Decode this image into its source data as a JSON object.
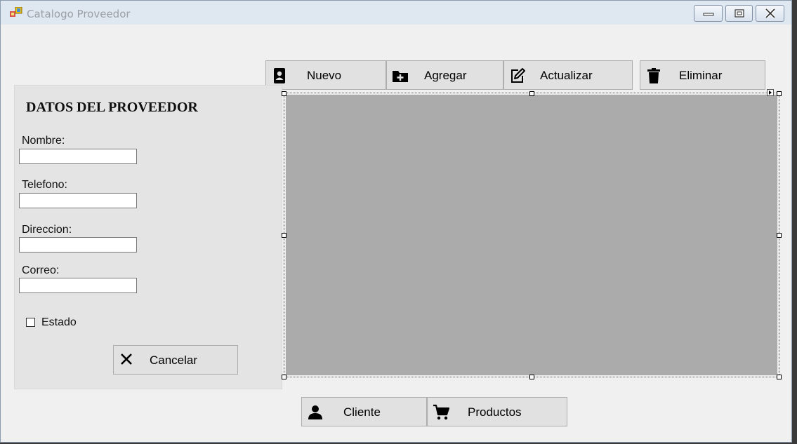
{
  "window": {
    "title": "Catalogo Proveedor",
    "controls": [
      "minimize-icon",
      "maximize-icon",
      "close-icon"
    ]
  },
  "toolbar": {
    "nuevo_label": "Nuevo",
    "agregar_label": "Agregar",
    "actualizar_label": "Actualizar",
    "eliminar_label": "Eliminar"
  },
  "form": {
    "title": "DATOS DEL PROVEEDOR",
    "fields": [
      {
        "label": "Nombre:",
        "value": ""
      },
      {
        "label": "Telefono:",
        "value": ""
      },
      {
        "label": "Direccion:",
        "value": ""
      },
      {
        "label": "Correo:",
        "value": ""
      }
    ],
    "estado_label": "Estado",
    "estado_checked": false,
    "cancel_label": "Cancelar"
  },
  "nav": {
    "cliente_label": "Cliente",
    "productos_label": "Productos"
  },
  "colors": {
    "grid_background": "#ababab",
    "button_face": "#e1e1e1",
    "panel_background": "#e4e4e4"
  }
}
